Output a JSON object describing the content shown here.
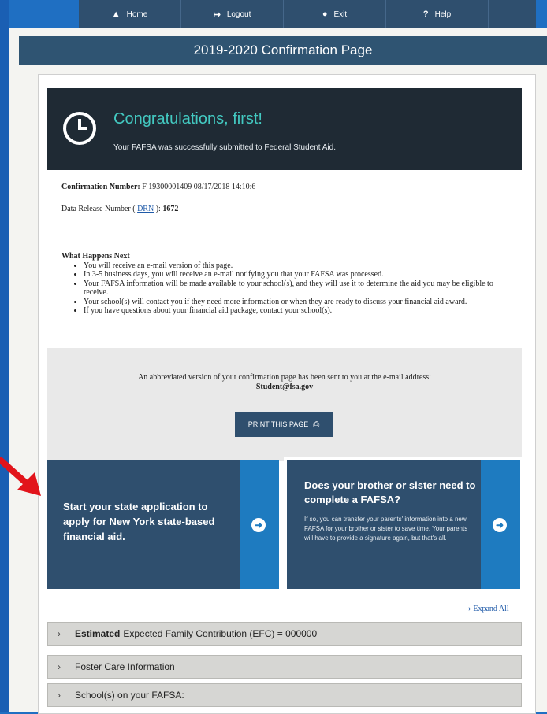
{
  "nav": {
    "items": [
      {
        "icon": "home-icon",
        "glyph": "▲",
        "label": "Home"
      },
      {
        "icon": "logout-icon",
        "glyph": "↦",
        "label": "Logout"
      },
      {
        "icon": "exit-icon",
        "glyph": "●",
        "label": "Exit"
      },
      {
        "icon": "help-icon",
        "glyph": "?",
        "label": "Help"
      }
    ]
  },
  "page_title": "2019-2020 Confirmation Page",
  "congrats": {
    "heading": "Congratulations, first!",
    "subtext": "Your FAFSA was successfully submitted to Federal Student Aid."
  },
  "confirmation": {
    "label": "Confirmation Number:",
    "value": "F 19300001409 08/17/2018 14:10:6"
  },
  "drn": {
    "prefix": "Data Release Number (",
    "link": "DRN",
    "suffix": "):",
    "value": "1672"
  },
  "what_next": {
    "heading": "What Happens Next",
    "items": [
      "You will receive an e-mail version of this page.",
      "In 3-5 business days, you will receive an e-mail notifying you that your FAFSA was processed.",
      "Your FAFSA information will be made available to your school(s), and they will use it to determine the aid you may be eligible to receive.",
      "Your school(s) will contact you if they need more information or when they are ready to discuss your financial aid award.",
      "If you have questions about your financial aid package, contact your school(s)."
    ]
  },
  "email_notice": {
    "text": "An abbreviated version of your confirmation page has been sent to you at the e-mail address:",
    "email": "Student@fsa.gov"
  },
  "print_button": "PRINT THIS PAGE",
  "promos": {
    "state": {
      "text": "Start your state application to apply for New York state-based financial aid."
    },
    "sibling": {
      "heading": "Does your brother or sister need to complete a FAFSA?",
      "body": "If so, you can transfer your parents' information into a new FAFSA for your brother or sister to save time. Your parents will have to provide a signature again, but that's all."
    }
  },
  "expand_all": "Expand All",
  "accordion": [
    {
      "bold": "Estimated",
      "label": "Expected Family Contribution (EFC) = 000000"
    },
    {
      "bold": "",
      "label": "Foster Care Information"
    },
    {
      "bold": "",
      "label": "School(s) on your FAFSA:"
    }
  ],
  "colors": {
    "nav_bg": "#2f4f6e",
    "title_bar": "#2f5472",
    "congrats_bg": "#1f2a34",
    "congrats_heading": "#43c9c1",
    "promo_bg": "#2f4f6e",
    "promo_arrow": "#1e7bc0",
    "annotation_arrow": "#e2141b"
  }
}
